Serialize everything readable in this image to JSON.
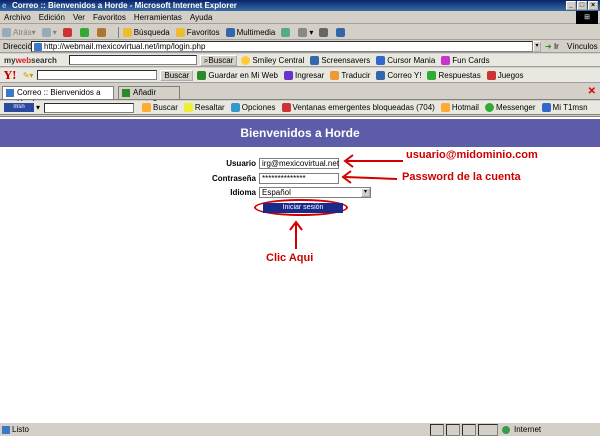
{
  "window": {
    "title": "Correo :: Bienvenidos a Horde - Microsoft Internet Explorer"
  },
  "menu": [
    "Archivo",
    "Edición",
    "Ver",
    "Favoritos",
    "Herramientas",
    "Ayuda"
  ],
  "toolbar": {
    "back": "Atrás",
    "search": "Búsqueda",
    "favorites": "Favoritos",
    "multimedia": "Multimedia"
  },
  "address": {
    "label": "Dirección",
    "url": "http://webmail.mexicovirtual.net/imp/login.php",
    "go": "Ir",
    "links": "Vínculos"
  },
  "mywebsearch": {
    "brand_a": "my",
    "brand_b": "web",
    "brand_c": "search",
    "search_btn": "Buscar",
    "items": [
      "Smiley Central",
      "Screensavers",
      "Cursor Mania",
      "Fun Cards"
    ]
  },
  "yahoo": {
    "logo": "Y!",
    "search_btn": "Buscar",
    "items": [
      "Guardar en Mi Web",
      "Ingresar",
      "Traducir",
      "Correo Y!",
      "Respuestas",
      "Juegos"
    ]
  },
  "tabs": {
    "active": "Correo :: Bienvenidos a Horde",
    "add": "Añadir pestaña"
  },
  "msn": {
    "logo": "msn",
    "items": [
      "Buscar",
      "Resaltar",
      "Opciones",
      "Ventanas emergentes bloqueadas (704)",
      "Hotmail",
      "Messenger",
      "Mi T1msn"
    ]
  },
  "page": {
    "header": "Bienvenidos a Horde",
    "user_label": "Usuario",
    "user_value": "irg@mexicovirtual.net",
    "pass_label": "Contraseña",
    "pass_value": "**************",
    "lang_label": "Idioma",
    "lang_value": "Español",
    "login_btn": "Iniciar sesión"
  },
  "annotations": {
    "user": "usuario@midominio.com",
    "pass": "Password de la cuenta",
    "click": "Clic Aqui",
    "color": "#d40000"
  },
  "status": {
    "text": "Listo",
    "zone": "Internet"
  }
}
